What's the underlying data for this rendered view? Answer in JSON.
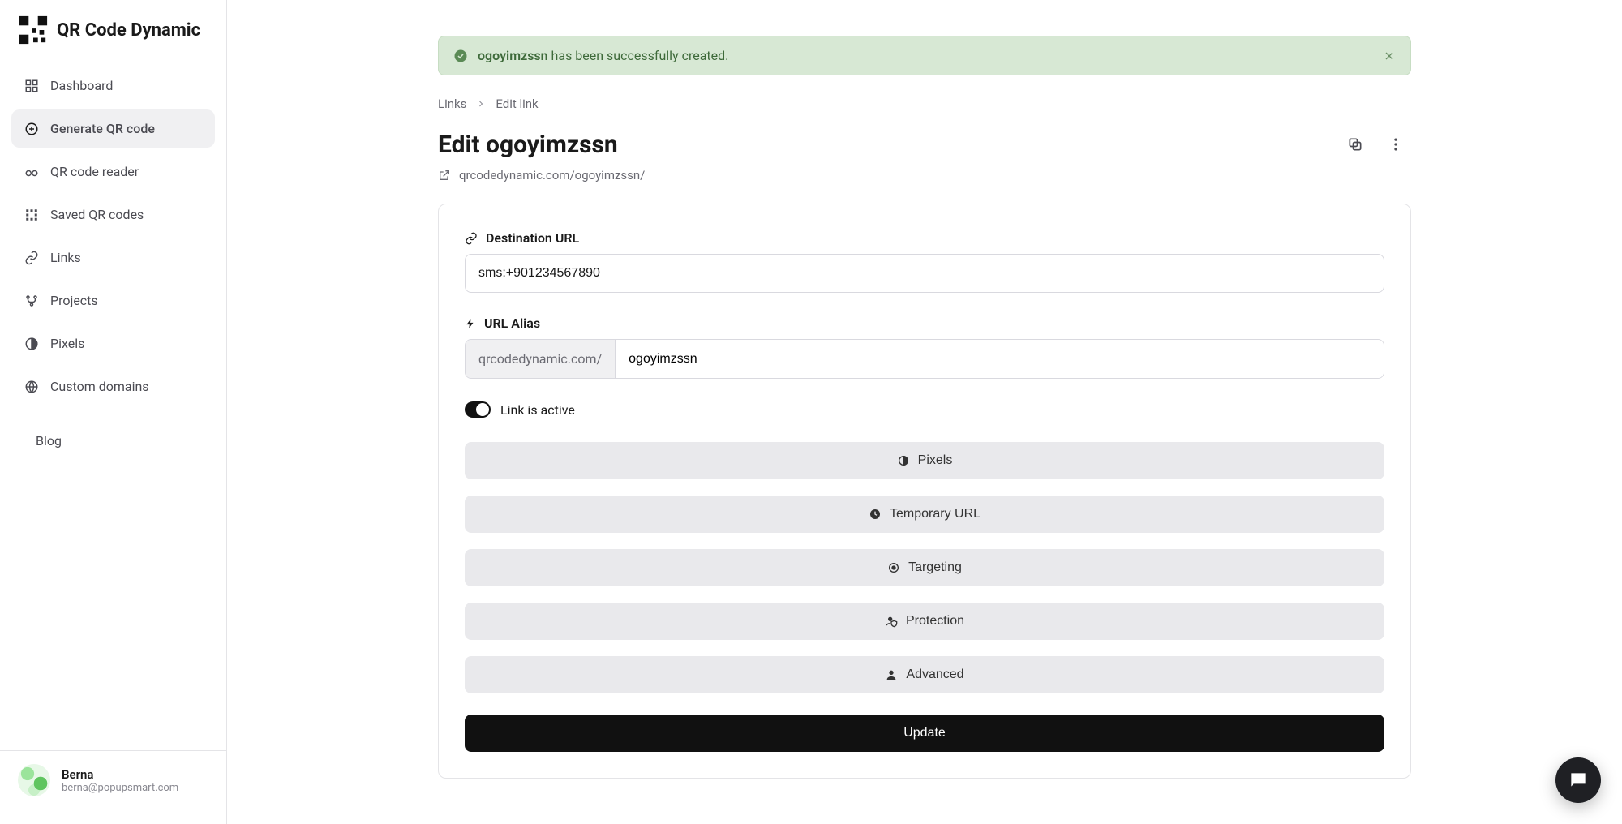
{
  "brand": {
    "name": "QR Code Dynamic"
  },
  "sidebar": {
    "items": [
      {
        "icon": "grid-icon",
        "label": "Dashboard"
      },
      {
        "icon": "plus-circle-icon",
        "label": "Generate QR code",
        "generate": true
      },
      {
        "icon": "glasses-icon",
        "label": "QR code reader"
      },
      {
        "icon": "qr-grid-icon",
        "label": "Saved QR codes"
      },
      {
        "icon": "link-icon",
        "label": "Links"
      },
      {
        "icon": "branch-icon",
        "label": "Projects"
      },
      {
        "icon": "pixels-icon",
        "label": "Pixels"
      },
      {
        "icon": "globe-icon",
        "label": "Custom domains"
      }
    ],
    "blog_label": "Blog",
    "user": {
      "name": "Berna",
      "email": "berna@popupsmart.com"
    }
  },
  "alert": {
    "bold": "ogoyimzssn",
    "rest": " has been successfully created."
  },
  "breadcrumb": {
    "root": "Links",
    "current": "Edit link"
  },
  "page": {
    "title": "Edit ogoyimzssn",
    "short_url": "qrcodedynamic.com/ogoyimzssn/"
  },
  "form": {
    "destination_label": "Destination URL",
    "destination_value": "sms:+901234567890",
    "alias_label": "URL Alias",
    "alias_prefix": "qrcodedynamic.com/",
    "alias_value": "ogoyimzssn",
    "active_label": "Link is active",
    "sections": {
      "pixels": "Pixels",
      "temporary": "Temporary URL",
      "targeting": "Targeting",
      "protection": "Protection",
      "advanced": "Advanced"
    },
    "update_label": "Update"
  }
}
